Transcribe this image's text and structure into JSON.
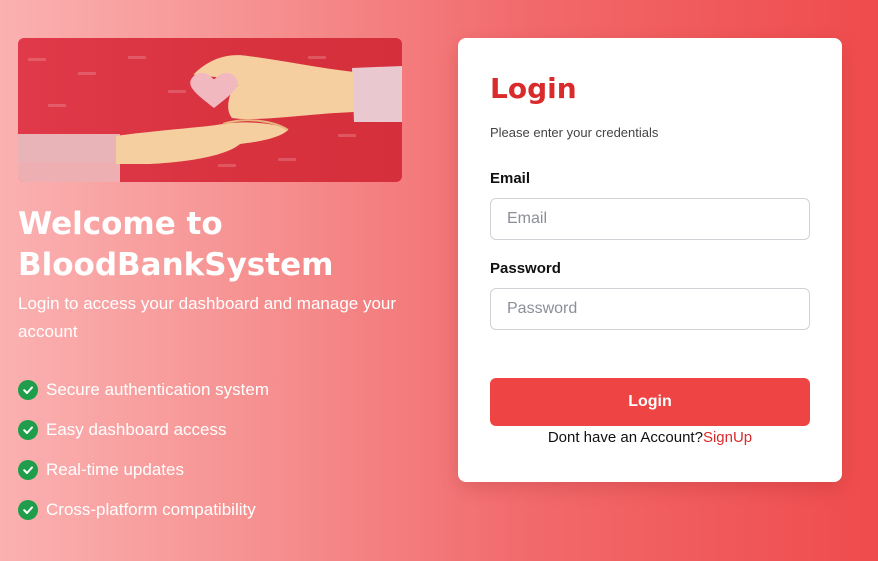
{
  "hero": {
    "welcome_title": "Welcome to BloodBankSystem",
    "subtitle": "Login to access your dashboard and manage your account",
    "features": [
      "Secure authentication system",
      "Easy dashboard access",
      "Real-time updates",
      "Cross-platform compatibility"
    ]
  },
  "login_card": {
    "title": "Login",
    "subtitle": "Please enter your credentials",
    "email_label": "Email",
    "email_placeholder": "Email",
    "email_value": "",
    "password_label": "Password",
    "password_placeholder": "Password",
    "password_value": "",
    "login_button": "Login",
    "signup_prompt": "Dont have an Account?",
    "signup_link": "SignUp"
  },
  "icons": {
    "feature_check": "check-circle-icon",
    "hero_image": "hands-with-heart-image"
  },
  "colors": {
    "accent": "#ef4444",
    "title_red": "#d92b2b",
    "check_green": "#1e9e4a"
  }
}
